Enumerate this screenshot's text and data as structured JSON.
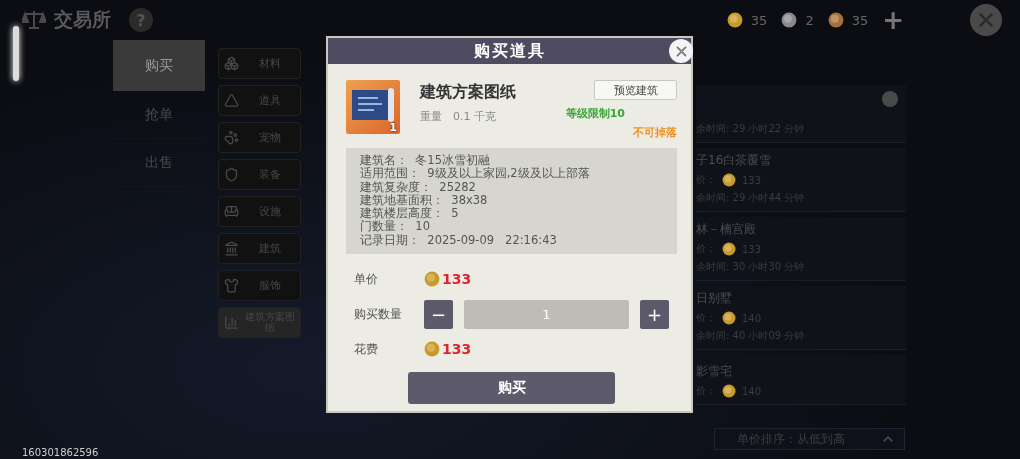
{
  "header": {
    "title": "交易所",
    "help": "?"
  },
  "currencies": [
    {
      "kind": "gold",
      "amount": "35"
    },
    {
      "kind": "silver",
      "amount": "2"
    },
    {
      "kind": "copper",
      "amount": "35"
    }
  ],
  "add_currency": "+",
  "nav_tabs": [
    {
      "label": "购买",
      "selected": true
    },
    {
      "label": "抢单",
      "selected": false
    },
    {
      "label": "出售",
      "selected": false
    }
  ],
  "categories": [
    {
      "label": "材料",
      "kind": "materials",
      "selected": false
    },
    {
      "label": "道具",
      "kind": "props",
      "selected": false
    },
    {
      "label": "宠物",
      "kind": "pets",
      "selected": false
    },
    {
      "label": "装备",
      "kind": "equipment",
      "selected": false
    },
    {
      "label": "设施",
      "kind": "facility",
      "selected": false
    },
    {
      "label": "建筑",
      "kind": "building",
      "selected": false
    },
    {
      "label": "服饰",
      "kind": "clothing",
      "selected": false
    },
    {
      "label": "建筑方案图纸",
      "kind": "blueprint",
      "selected": true
    }
  ],
  "listings": [
    {
      "time": "余时间: 29 小时22 分钟",
      "refresh": true
    },
    {
      "title": "子16白茶覆雪",
      "price_label": "价：",
      "price": "133",
      "time": "余时间: 29 小时44 分钟"
    },
    {
      "title": "林－楠宫殿",
      "price_label": "价：",
      "price": "133",
      "time": "余时间: 30 小时30 分钟"
    },
    {
      "title": "日别墅",
      "price_label": "价：",
      "price": "140",
      "time": "余时间: 40 小时09 分钟"
    },
    {
      "title": "影雪宅",
      "price_label": "价：",
      "price": "140"
    }
  ],
  "sort": {
    "label": "单价排序：从低到高"
  },
  "player_id": "160301862596",
  "dialog": {
    "title": "购买道具",
    "item": {
      "name": "建筑方案图纸",
      "count": "1",
      "weight": "重量　0.1 千克",
      "level_limit": "等级限制10",
      "drop": "不可掉落",
      "preview_button": "预览建筑"
    },
    "details": [
      "建筑名：  冬15冰雪初融",
      "适用范围：  9级及以上家园,2级及以上部落",
      "建筑复杂度：  25282",
      "建筑地基面积：  38x38",
      "建筑楼层高度：  5",
      "门数量：  10",
      "记录日期：  2025-09-09   22:16:43"
    ],
    "unit_price_label": "单价",
    "unit_price": "133",
    "quantity_label": "购买数量",
    "quantity": "1",
    "minus": "−",
    "plus": "+",
    "cost_label": "花费",
    "cost": "133",
    "buy_button": "购买"
  }
}
